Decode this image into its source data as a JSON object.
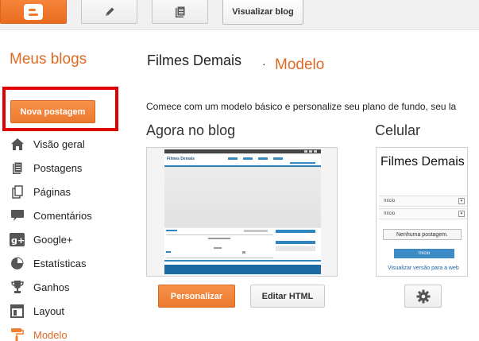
{
  "toolbar": {
    "logo_icon": "blogger-logo-icon",
    "edit_icon": "pencil-icon",
    "posts_icon": "document-icon",
    "view_blog_label": "Visualizar blog"
  },
  "sidebar": {
    "title": "Meus blogs",
    "new_post_label": "Nova postagem",
    "items": [
      {
        "label": "Visão geral",
        "icon": "home-icon"
      },
      {
        "label": "Postagens",
        "icon": "posts-icon"
      },
      {
        "label": "Páginas",
        "icon": "pages-icon"
      },
      {
        "label": "Comentários",
        "icon": "comment-icon"
      },
      {
        "label": "Google+",
        "icon": "google-plus-icon"
      },
      {
        "label": "Estatísticas",
        "icon": "pie-chart-icon"
      },
      {
        "label": "Ganhos",
        "icon": "trophy-icon"
      },
      {
        "label": "Layout",
        "icon": "layout-icon"
      },
      {
        "label": "Modelo",
        "icon": "paint-roller-icon",
        "active": true
      }
    ]
  },
  "main": {
    "blog_name": "Filmes Demais",
    "separator": "·",
    "page_name": "Modelo",
    "intro": "Comece com um modelo básico e personalize seu plano de fundo, seu la",
    "current_heading": "Agora no blog",
    "mobile_heading": "Celular",
    "mobile_preview": {
      "title": "Filmes Demais",
      "select_1": "Início",
      "select_2": "Início",
      "no_posts": "Nenhuma postagem.",
      "start_button": "Início",
      "web_link": "Visualizar versão para a web"
    },
    "customize_label": "Personalizar",
    "edit_html_label": "Editar HTML",
    "settings_icon": "gear-icon"
  },
  "colors": {
    "accent": "#dd6a23",
    "button_orange": "#ef7f33",
    "highlight_box": "#e00000",
    "link_blue": "#1f63a6"
  }
}
